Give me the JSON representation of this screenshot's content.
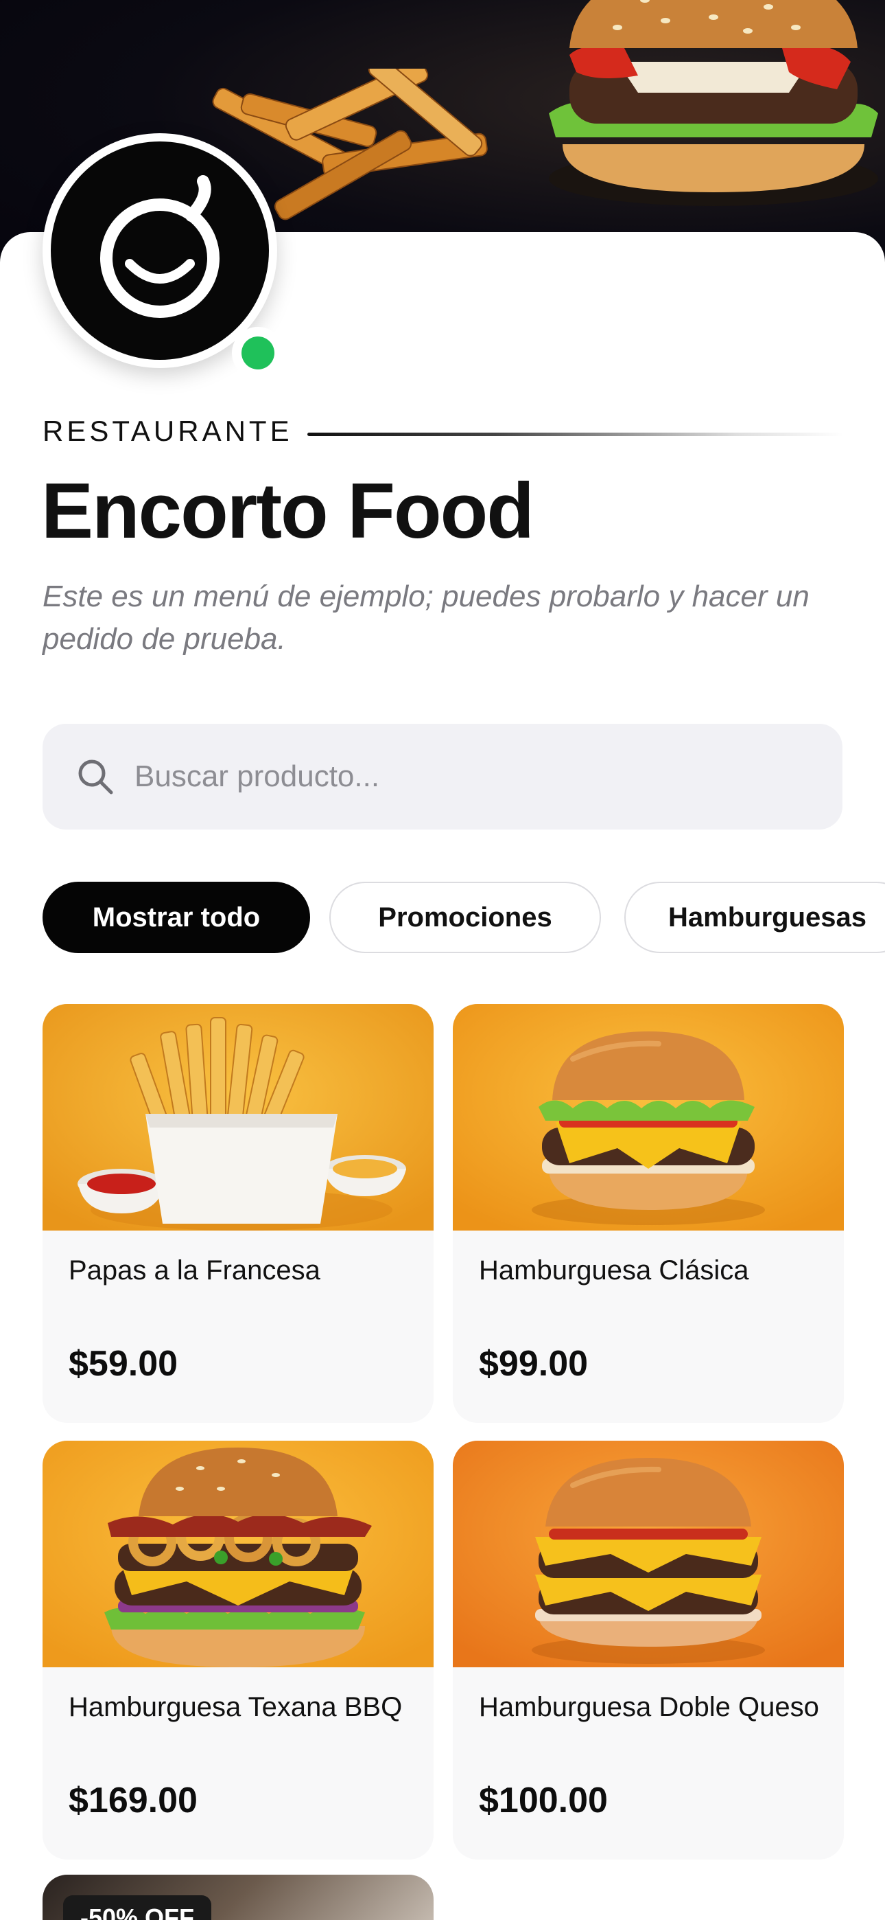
{
  "restaurant": {
    "category": "RESTAURANTE",
    "name": "Encorto Food",
    "description": "Este es un menú de ejemplo; puedes probarlo y hacer un pedido de prueba.",
    "status": "online"
  },
  "search": {
    "placeholder": "Buscar producto...",
    "value": ""
  },
  "filters": [
    {
      "label": "Mostrar todo",
      "selected": true
    },
    {
      "label": "Promociones",
      "selected": false
    },
    {
      "label": "Hamburguesas",
      "selected": false
    }
  ],
  "products": [
    {
      "name": "Papas a la Francesa",
      "price": "$59.00",
      "image": "fries-image"
    },
    {
      "name": "Hamburguesa Clásica",
      "price": "$99.00",
      "image": "classic-burger-image"
    },
    {
      "name": "Hamburguesa Texana BBQ",
      "price": "$169.00",
      "image": "bbq-burger-image"
    },
    {
      "name": "Hamburguesa Doble Queso",
      "price": "$100.00",
      "image": "double-cheese-burger-image"
    }
  ],
  "promo_product": {
    "badge": "-50% OFF"
  },
  "colors": {
    "accent": "#050505",
    "online": "#1fc15a",
    "card_background": "#f8f8f9",
    "search_background": "#f1f1f5"
  }
}
